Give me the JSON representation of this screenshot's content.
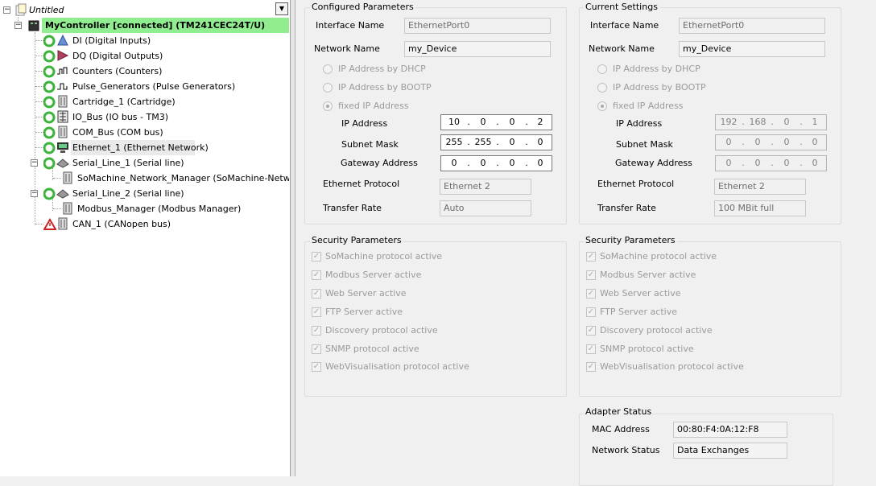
{
  "tree": {
    "root": "Untitled",
    "controller": "MyController [connected] (TM241CEC24T/U)",
    "items": [
      {
        "label": "DI (Digital Inputs)",
        "icon": "digital-inputs-icon"
      },
      {
        "label": "DQ (Digital Outputs)",
        "icon": "digital-outputs-icon"
      },
      {
        "label": "Counters (Counters)",
        "icon": "counters-icon"
      },
      {
        "label": "Pulse_Generators (Pulse Generators)",
        "icon": "pulse-generators-icon"
      },
      {
        "label": "Cartridge_1 (Cartridge)",
        "icon": "cartridge-icon"
      },
      {
        "label": "IO_Bus (IO bus - TM3)",
        "icon": "io-bus-icon"
      },
      {
        "label": "COM_Bus (COM bus)",
        "icon": "com-bus-icon"
      },
      {
        "label": "Ethernet_1 (Ethernet Network)",
        "icon": "ethernet-icon"
      },
      {
        "label": "Serial_Line_1 (Serial line)",
        "icon": "serial-line-icon"
      },
      {
        "label": "SoMachine_Network_Manager (SoMachine-Network Ma",
        "icon": "network-manager-icon"
      },
      {
        "label": "Serial_Line_2 (Serial line)",
        "icon": "serial-line-icon"
      },
      {
        "label": "Modbus_Manager (Modbus Manager)",
        "icon": "modbus-manager-icon"
      },
      {
        "label": "CAN_1 (CANopen bus)",
        "icon": "can-bus-icon"
      }
    ]
  },
  "configured": {
    "title": "Configured Parameters",
    "interface_name_label": "Interface Name",
    "interface_name": "EthernetPort0",
    "network_name_label": "Network Name",
    "network_name": "my_Device",
    "dhcp_label": "IP Address by DHCP",
    "bootp_label": "IP Address by BOOTP",
    "fixed_label": "fixed IP Address",
    "ip_label": "IP Address",
    "ip": [
      "10",
      "0",
      "0",
      "2"
    ],
    "mask_label": "Subnet Mask",
    "mask": [
      "255",
      "255",
      "0",
      "0"
    ],
    "gateway_label": "Gateway Address",
    "gateway": [
      "0",
      "0",
      "0",
      "0"
    ],
    "protocol_label": "Ethernet Protocol",
    "protocol": "Ethernet 2",
    "rate_label": "Transfer Rate",
    "rate": "Auto"
  },
  "current": {
    "title": "Current Settings",
    "interface_name_label": "Interface Name",
    "interface_name": "EthernetPort0",
    "network_name_label": "Network Name",
    "network_name": "my_Device",
    "dhcp_label": "IP Address by DHCP",
    "bootp_label": "IP Address by BOOTP",
    "fixed_label": "fixed IP Address",
    "ip_label": "IP Address",
    "ip": [
      "192",
      "168",
      "0",
      "1"
    ],
    "mask_label": "Subnet Mask",
    "mask": [
      "0",
      "0",
      "0",
      "0"
    ],
    "gateway_label": "Gateway Address",
    "gateway": [
      "0",
      "0",
      "0",
      "0"
    ],
    "protocol_label": "Ethernet Protocol",
    "protocol": "Ethernet 2",
    "rate_label": "Transfer Rate",
    "rate": "100 MBit full"
  },
  "security_left": {
    "title": "Security Parameters",
    "items": [
      "SoMachine protocol active",
      "Modbus Server active",
      "Web Server active",
      "FTP Server active",
      "Discovery protocol active",
      "SNMP protocol active",
      "WebVisualisation protocol active"
    ]
  },
  "security_right": {
    "title": "Security Parameters",
    "items": [
      "SoMachine protocol active",
      "Modbus Server active",
      "Web Server active",
      "FTP Server active",
      "Discovery protocol active",
      "SNMP protocol active",
      "WebVisualisation protocol active"
    ]
  },
  "adapter": {
    "title": "Adapter Status",
    "mac_label": "MAC Address",
    "mac": "00:80:F4:0A:12:F8",
    "status_label": "Network Status",
    "status": "Data Exchanges"
  },
  "colors": {
    "connected_highlight": "#90ee90",
    "ok_icon": "#3cb43c",
    "error_icon": "#cc2222"
  }
}
